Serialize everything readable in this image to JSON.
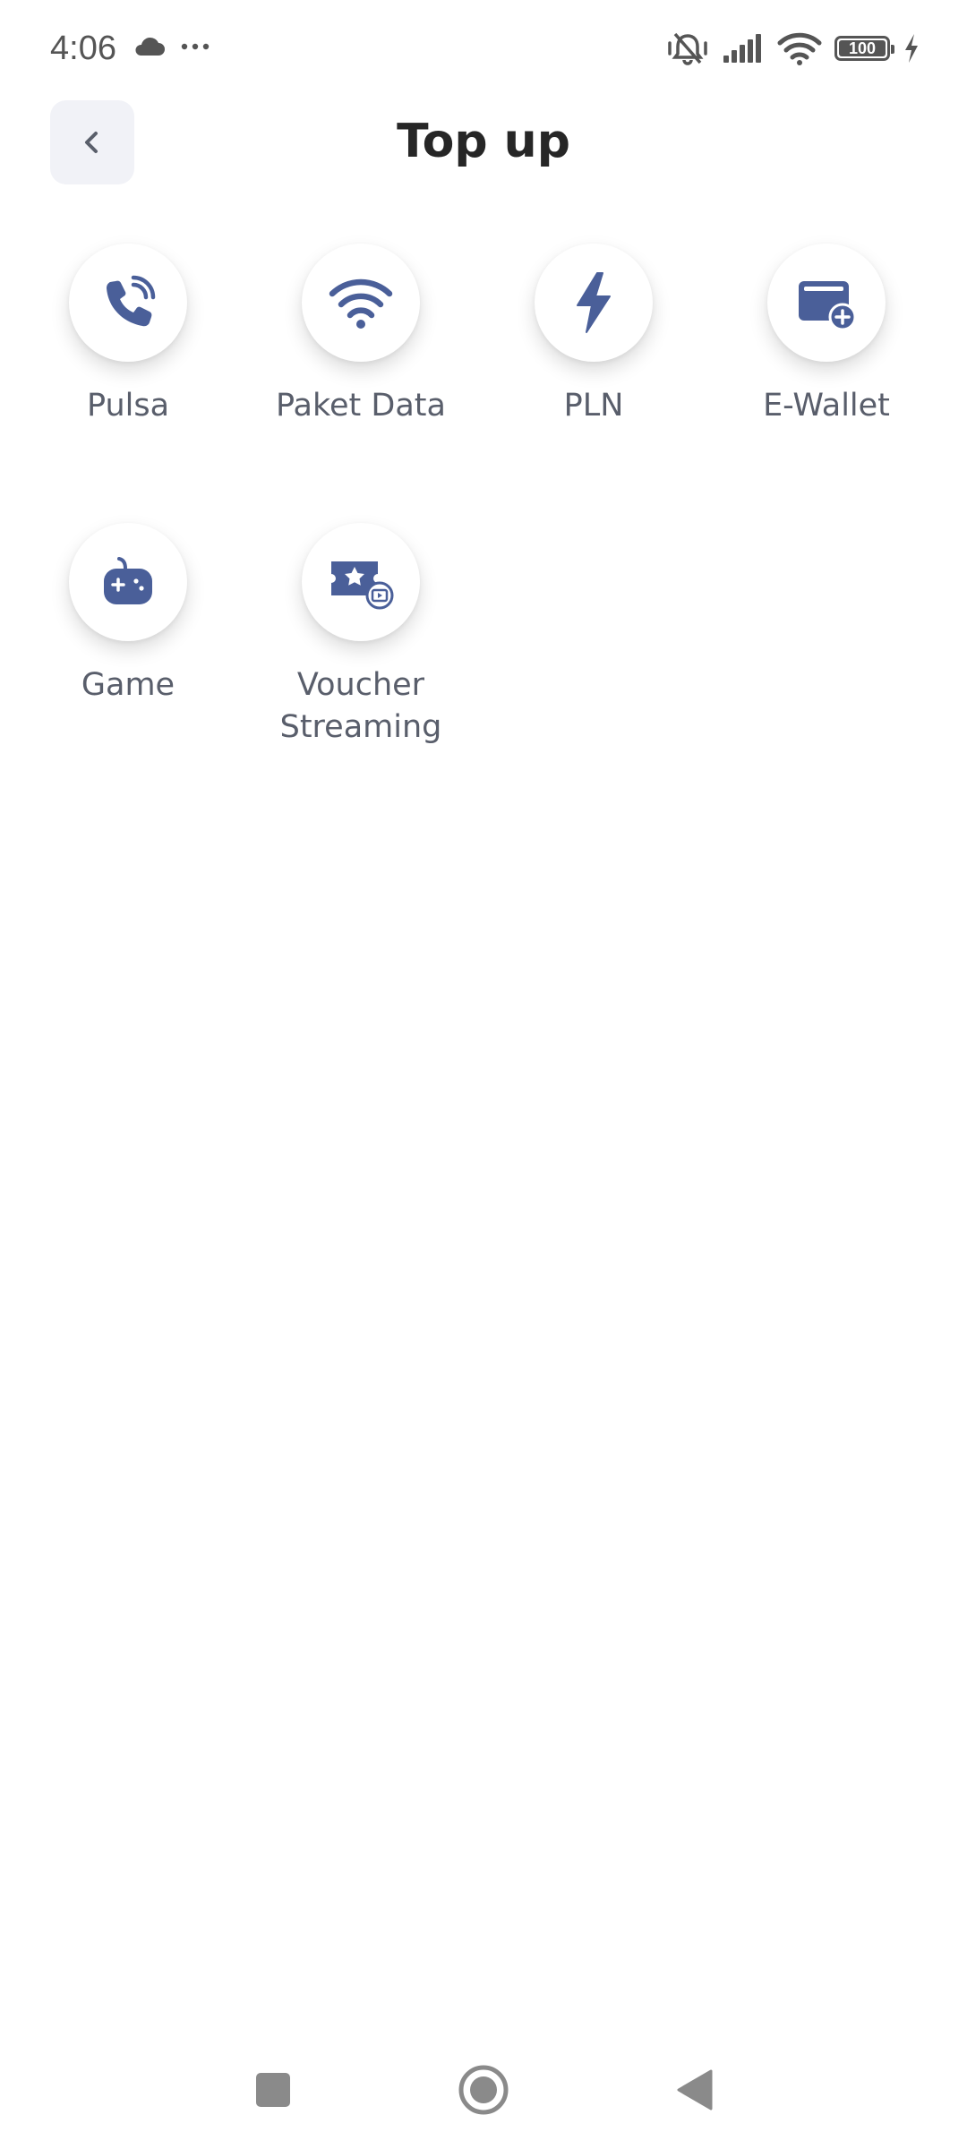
{
  "status_bar": {
    "time": "4:06",
    "battery_level": "100",
    "colors": {
      "icon": "#555555"
    },
    "icons": [
      "cloud-icon",
      "more-dots-icon",
      "vibrate-silent-icon",
      "signal-icon",
      "wifi-icon",
      "battery-icon",
      "charging-icon"
    ]
  },
  "header": {
    "title": "Top up",
    "back_icon": "chevron-left-icon"
  },
  "services": [
    {
      "label": "Pulsa",
      "icon": "phone-icon"
    },
    {
      "label": "Paket Data",
      "icon": "wifi-icon"
    },
    {
      "label": "PLN",
      "icon": "lightning-icon"
    },
    {
      "label": "E-Wallet",
      "icon": "wallet-add-icon"
    },
    {
      "label": "Game",
      "icon": "gamepad-icon"
    },
    {
      "label": "Voucher\nStreaming",
      "icon": "ticket-star-icon"
    }
  ],
  "theme": {
    "icon_color": "#4a5f99",
    "label_color": "#595e6b",
    "title_color": "#262626",
    "back_bg": "#f1f2f7"
  },
  "nav_bar": {
    "icons": [
      "recent-apps-icon",
      "home-icon",
      "back-icon"
    ]
  }
}
